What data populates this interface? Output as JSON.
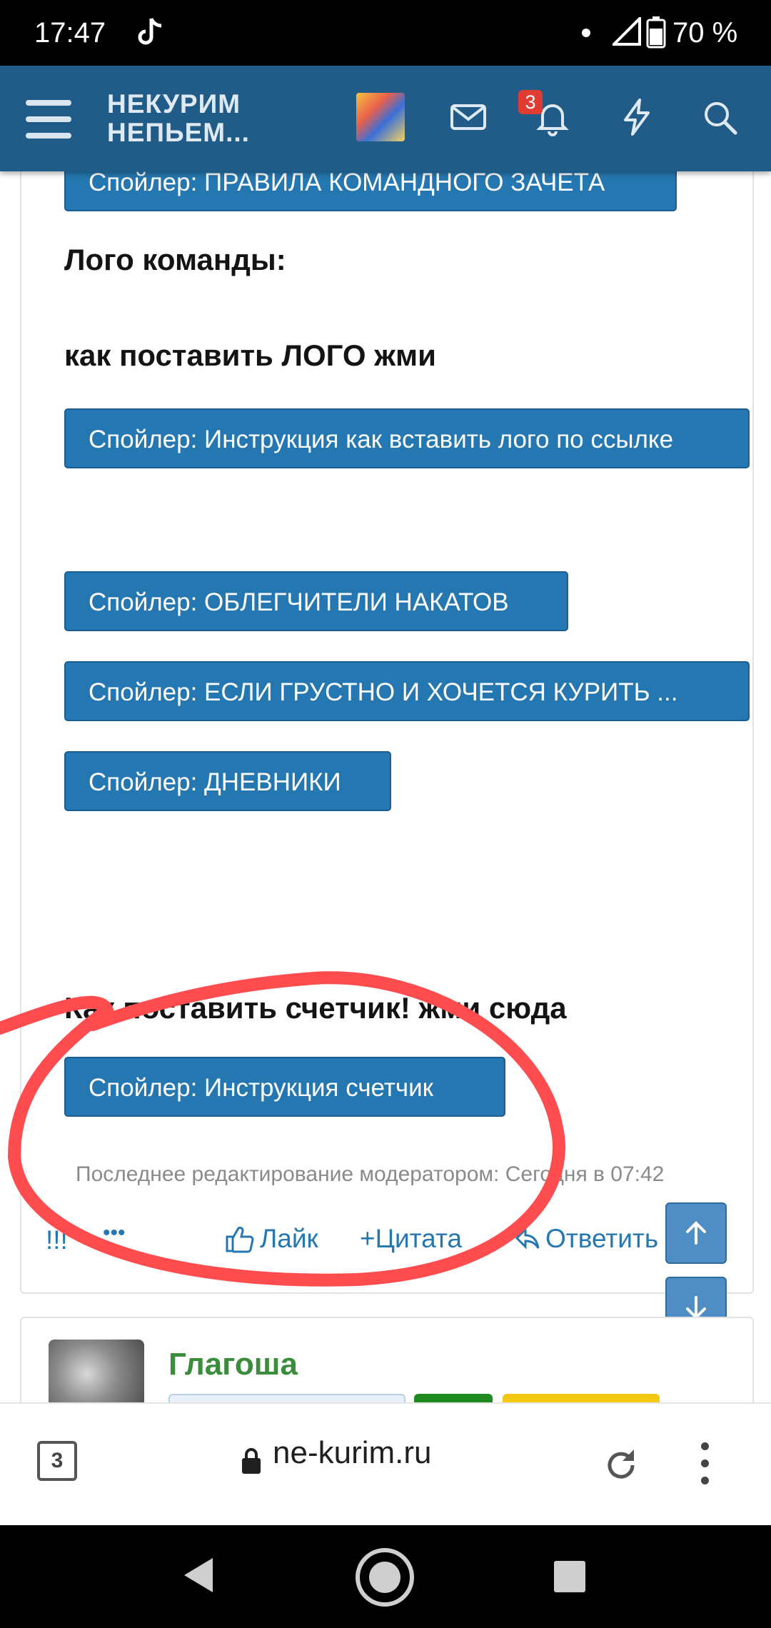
{
  "status": {
    "time": "17:47",
    "battery": "70 %"
  },
  "header": {
    "title_line1": "НЕКУРИМ",
    "title_line2": "НЕПЬЕМ...",
    "notification_count": "3"
  },
  "post": {
    "spoilers": [
      "Спойлер: ПРАВИЛА КОМАНДНОГО ЗАЧЕТА",
      "Спойлер: Инструкция как вставить лого по ссылке",
      "Спойлер: ОБЛЕГЧИТЕЛИ НАКАТОВ",
      "Спойлер: ЕСЛИ ГРУСТНО И ХОЧЕТСЯ КУРИТЬ ...",
      "Спойлер: ДНЕВНИКИ",
      "Спойлер: Инструкция счетчик"
    ],
    "headings": [
      "Лого команды:",
      "как поставить ЛОГО жми",
      "Как поставить счетчик! жми сюда"
    ],
    "edit_note": "Последнее редактирование модератором: Сегодня в 07:42",
    "actions": {
      "report": "!!!",
      "more": "•••",
      "like": "Лайк",
      "quote": "Цитата",
      "reply": "Ответить"
    }
  },
  "next_post": {
    "username": "Глагоша"
  },
  "browser": {
    "tab_count": "3",
    "url": "ne-kurim.ru"
  },
  "colors": {
    "header": "#215c88",
    "button": "#2577b1",
    "accent_red": "#e03c31"
  }
}
